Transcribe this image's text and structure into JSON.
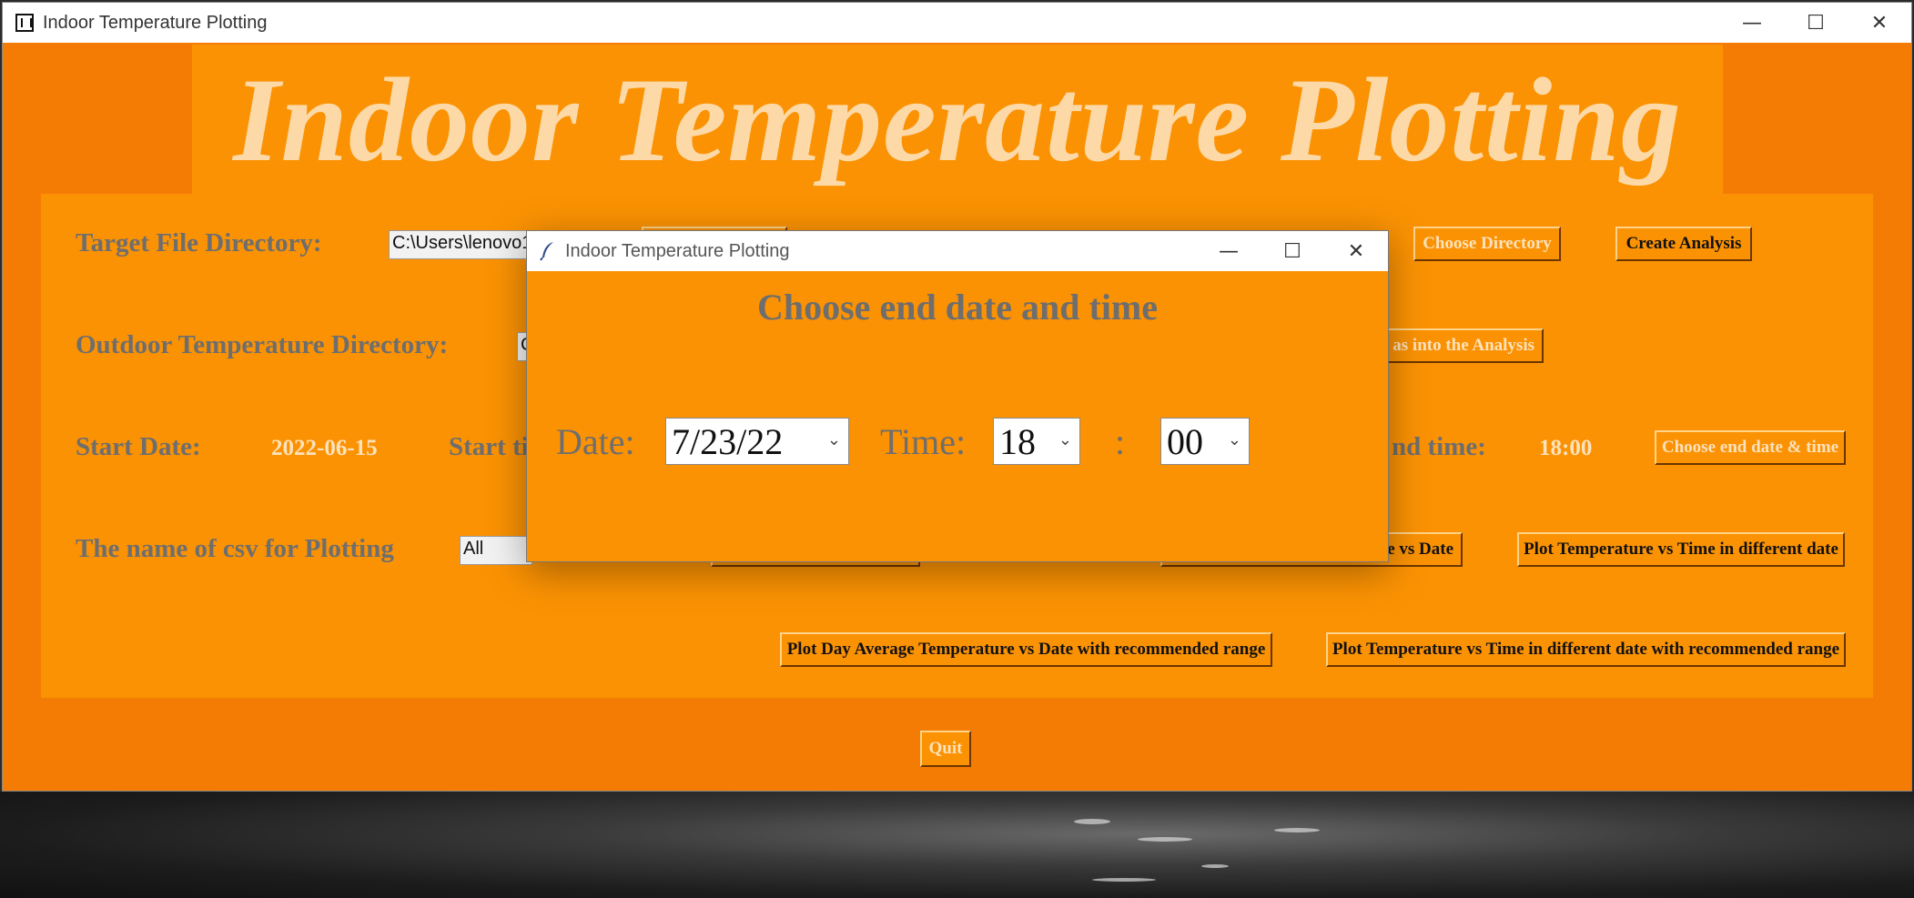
{
  "main_window": {
    "title": "Indoor Temperature Plotting",
    "banner_title": "Indoor Temperature Plotting",
    "quit_label": "Quit"
  },
  "form": {
    "target_dir_label": "Target File Directory:",
    "target_dir_value": "C:\\Users\\lenovo1",
    "choose_directory_label": "Choose Directory",
    "create_analysis_label": "Create Analysis",
    "outdoor_dir_label": "Outdoor Temperature Directory:",
    "outdoor_dir_value": "C",
    "add_outdoor_label_partial": "as into the Analysis",
    "start_date_label": "Start Date:",
    "start_date_value": "2022-06-15",
    "start_time_label_partial": "Start ti",
    "end_time_label_partial": "nd time:",
    "end_time_value": "18:00",
    "choose_end_label": "Choose end date & time",
    "csv_label": "The name of csv for Plotting",
    "csv_value": "All",
    "plot_vs_date_partial": "e vs Date",
    "plot_time_diff_date_label": "Plot Temperature vs Time in different date",
    "plot_day_avg_range_label": "Plot Day Average Temperature vs Date with recommended range",
    "plot_time_diff_date_range_label": "Plot Temperature vs Time in different date with recommended range"
  },
  "dialog": {
    "title": "Indoor Temperature Plotting",
    "heading": "Choose end date and time",
    "date_label": "Date:",
    "date_value": "7/23/22",
    "time_label": "Time:",
    "hour_value": "18",
    "separator": ":",
    "minute_value": "00"
  },
  "window_controls": {
    "minimize": "—",
    "maximize": "☐",
    "close": "✕"
  },
  "colors": {
    "window_bg": "#f57c04",
    "panel_bg": "#fb9203",
    "banner_text": "#fcd9a6",
    "label_gray": "#6e6e6e"
  }
}
